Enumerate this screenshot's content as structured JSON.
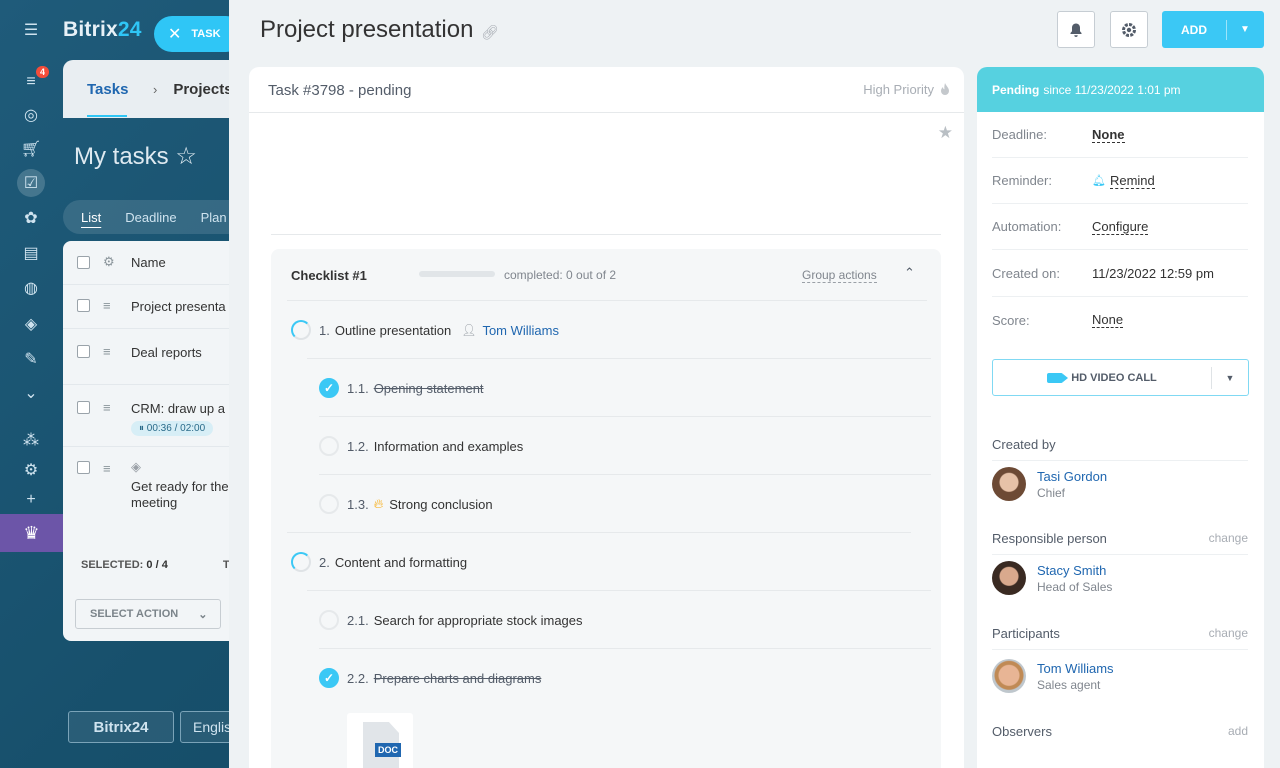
{
  "background": {
    "logo_prefix": "Bitrix",
    "logo_suffix": "24",
    "badge_count": "4",
    "task_pill_label": "TASK",
    "tabs": [
      "Tasks",
      "Projects"
    ],
    "page_title": "My tasks",
    "views": [
      "List",
      "Deadline",
      "Plan"
    ],
    "list_header": "Name",
    "list_rows": [
      {
        "name": "Project presenta"
      },
      {
        "name": "Deal reports"
      },
      {
        "name": "CRM: draw up a",
        "timer": "00:36 / 02:00"
      },
      {
        "name": "Get ready for the meeting"
      }
    ],
    "selected_label": "SELECTED:",
    "selected_value": "0 / 4",
    "total_fragment": "TO",
    "select_action": "SELECT ACTION",
    "footer_logo": "Bitrix24",
    "language": "Englis"
  },
  "header": {
    "title": "Project presentation",
    "add_label": "ADD"
  },
  "task": {
    "id_label": "Task #3798 - pending",
    "priority_label": "High Priority"
  },
  "checklist": {
    "title": "Checklist #1",
    "progress": 0,
    "completed_label": "completed: 0 out of 2",
    "group_actions": "Group actions",
    "items": [
      {
        "num": "1.",
        "text": "Outline presentation",
        "assignee": "Tom Williams",
        "state": "partial"
      },
      {
        "num": "1.1.",
        "text": "Opening statement",
        "state": "done"
      },
      {
        "num": "1.2.",
        "text": "Information and examples",
        "state": "open"
      },
      {
        "num": "1.3.",
        "text": "Strong conclusion",
        "state": "open",
        "important": true
      },
      {
        "num": "2.",
        "text": "Content and formatting",
        "state": "partial"
      },
      {
        "num": "2.1.",
        "text": "Search for appropriate stock images",
        "state": "open"
      },
      {
        "num": "2.2.",
        "text": "Prepare charts and diagrams",
        "state": "done"
      }
    ],
    "attachment_type": "DOC"
  },
  "sidebar": {
    "status_label": "Pending",
    "status_since": "since 11/23/2022 1:01 pm",
    "props": [
      {
        "key": "Deadline:",
        "value": "None"
      },
      {
        "key": "Reminder:",
        "value": "Remind"
      },
      {
        "key": "Automation:",
        "value": "Configure"
      },
      {
        "key": "Created on:",
        "value": "11/23/2022 12:59 pm"
      },
      {
        "key": "Score:",
        "value": "None"
      }
    ],
    "video_call_label": "HD VIDEO CALL",
    "created_by_label": "Created by",
    "creator": {
      "name": "Tasi Gordon",
      "role": "Chief"
    },
    "responsible_label": "Responsible person",
    "responsible_action": "change",
    "responsible": {
      "name": "Stacy Smith",
      "role": "Head of Sales"
    },
    "participants_label": "Participants",
    "participants_action": "change",
    "participant": {
      "name": "Tom Williams",
      "role": "Sales agent"
    },
    "observers_label": "Observers",
    "observers_action": "add"
  }
}
